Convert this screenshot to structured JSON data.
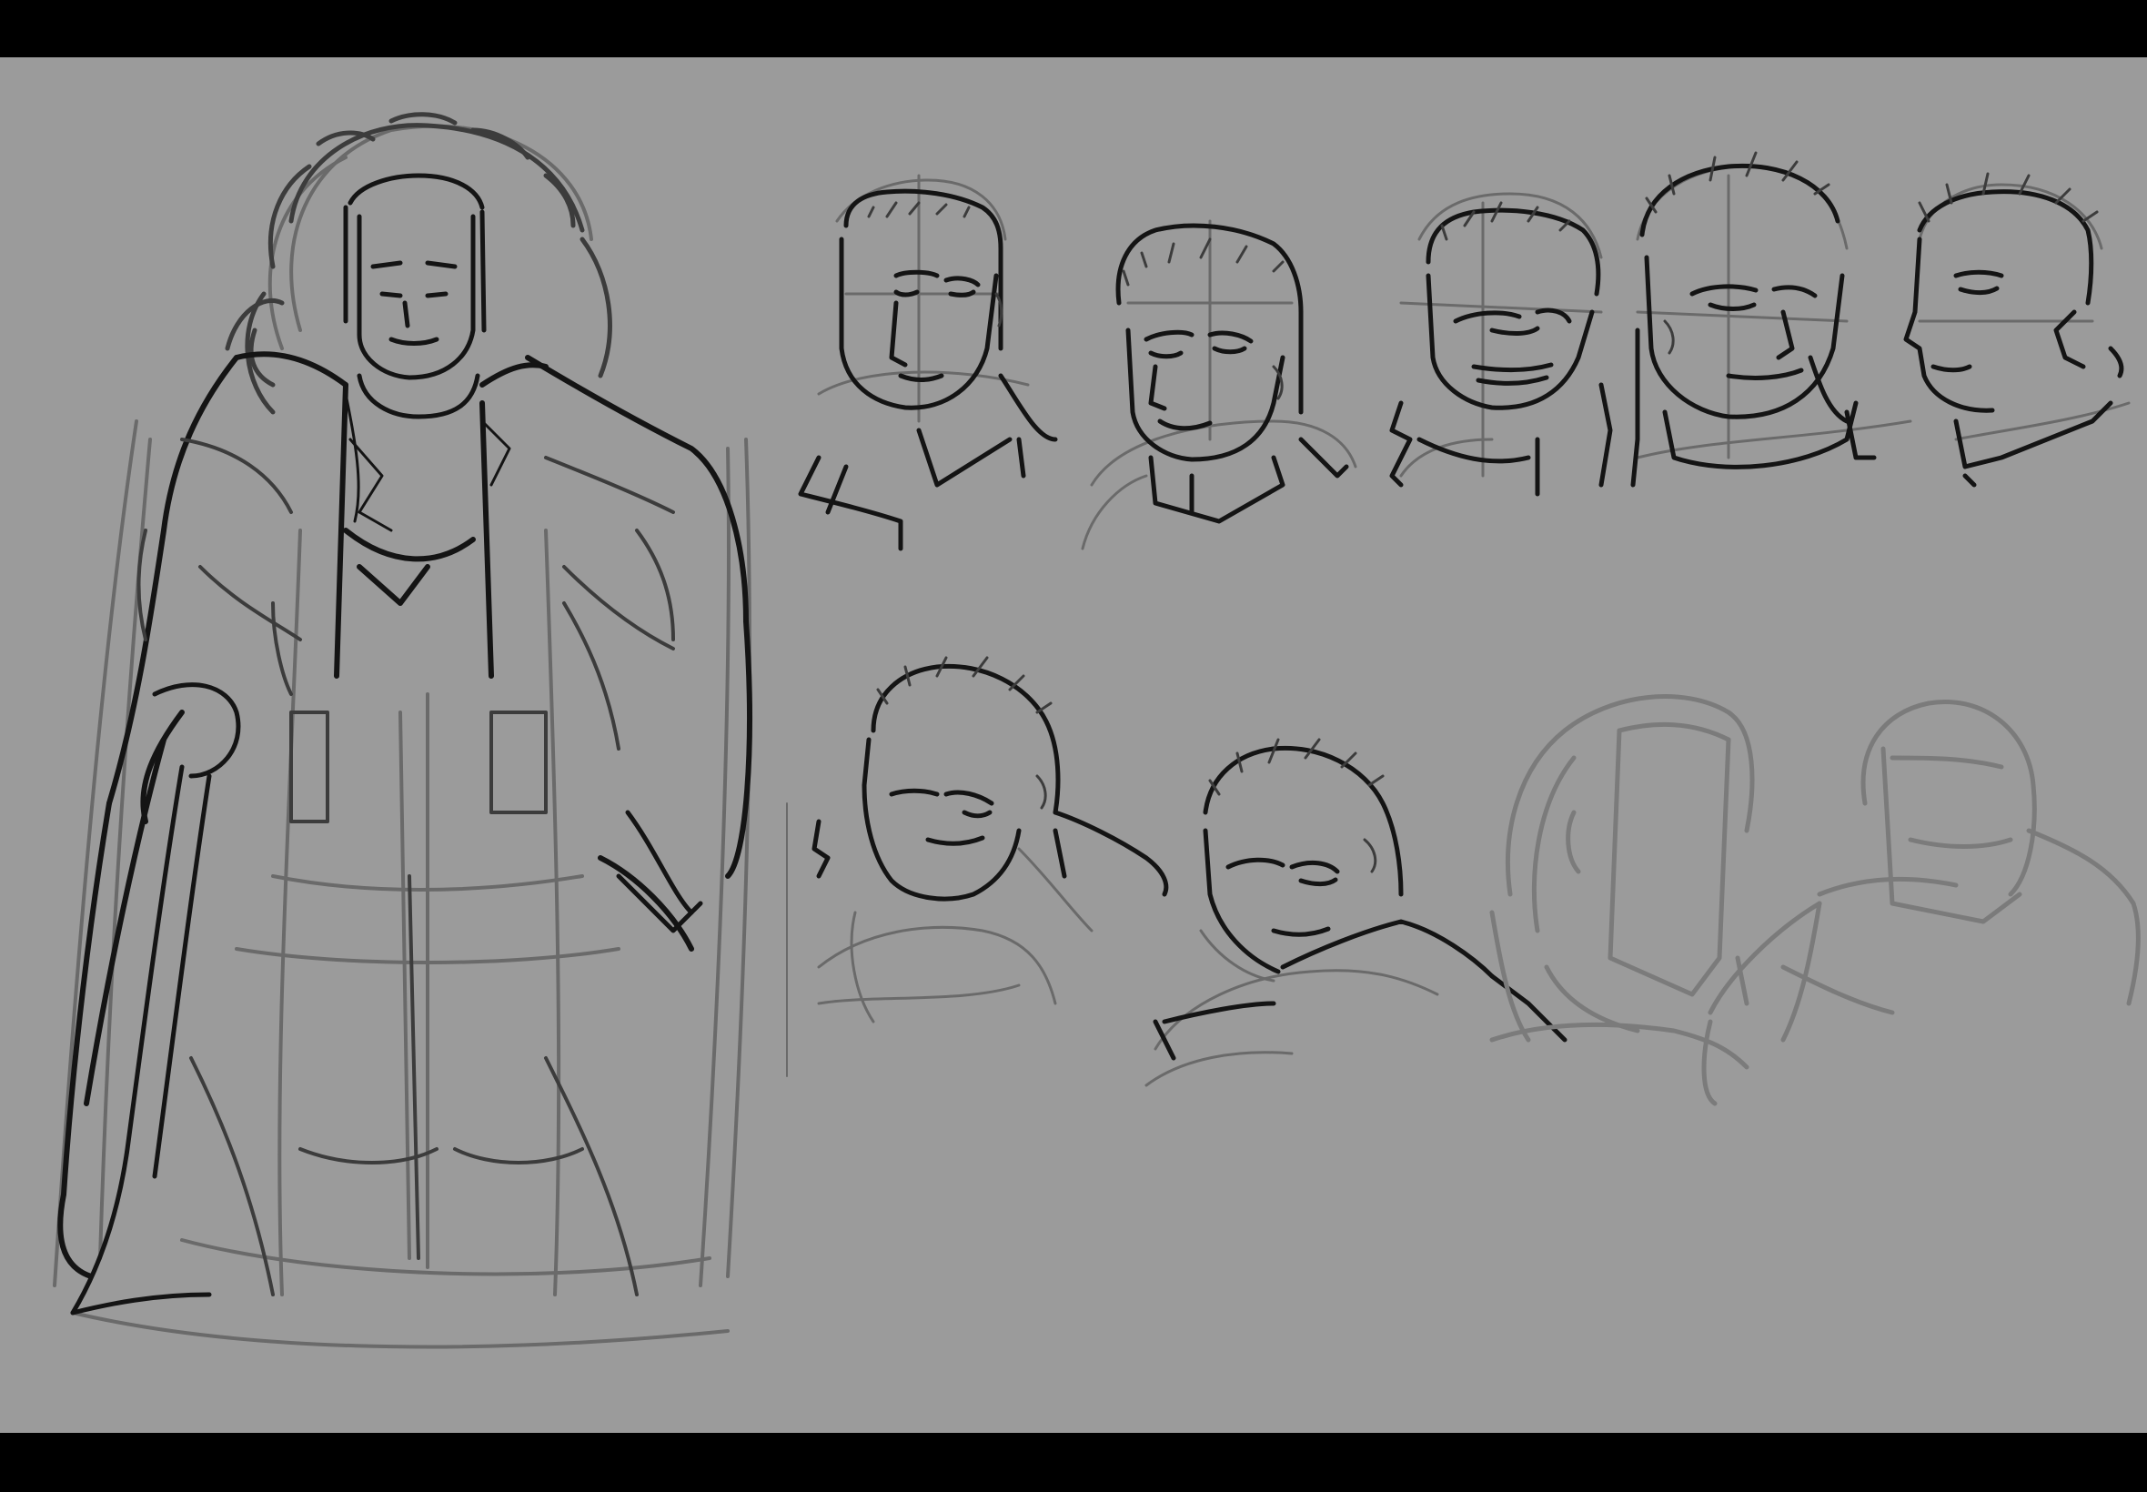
{
  "colors": {
    "canvas_background": "#9b9b9b",
    "letterbox": "#000000",
    "ink_dark": "#141414",
    "sketch_light": "#6a6a6a"
  },
  "artwork": {
    "subject": "character-sketch-sheet",
    "full_figure": 1,
    "head_studies_row_1": 5,
    "head_studies_row_2": 2,
    "rough_head_studies_row_2": 2
  }
}
